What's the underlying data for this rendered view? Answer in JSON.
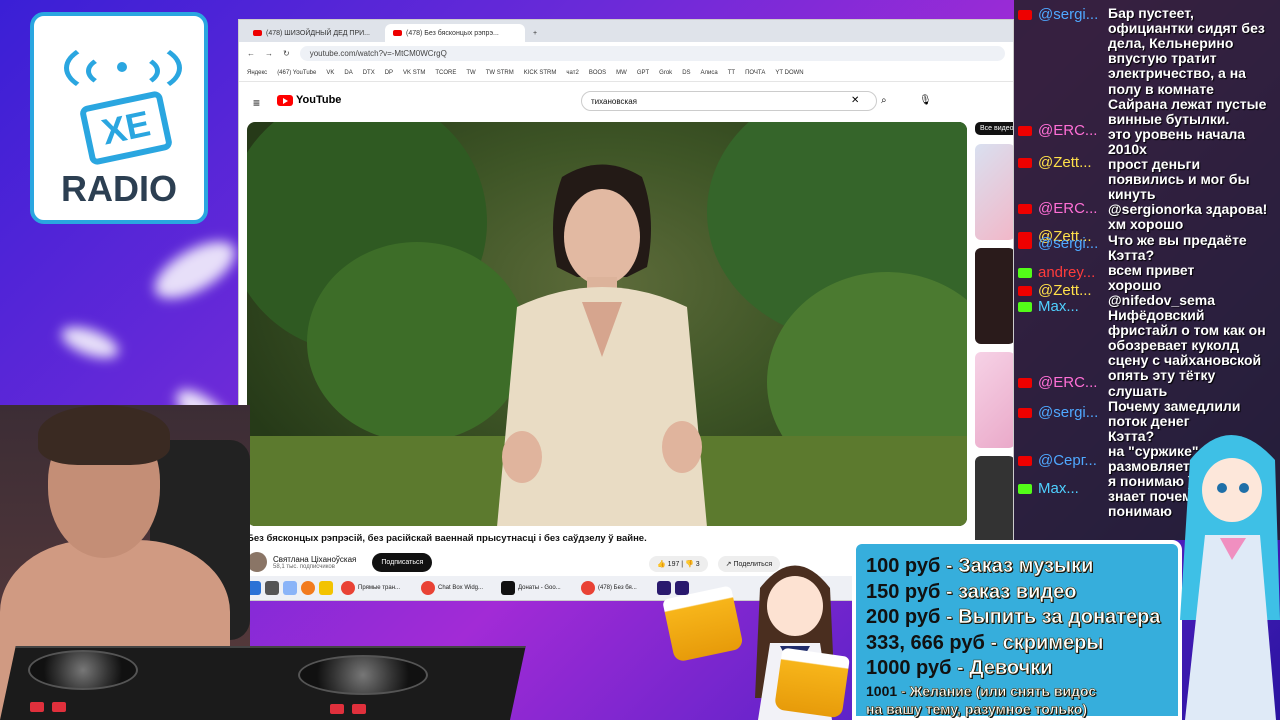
{
  "logo": {
    "text": "XE",
    "radio": "RADIO"
  },
  "browser": {
    "tabs": [
      {
        "label": "(478) ШИЗОЙДНЫЙ ДЕД ПРИ..."
      },
      {
        "label": "(478) Без бясконцых рэпрэ..."
      }
    ],
    "new_tab": "+",
    "url": "youtube.com/watch?v=-MtCM0WCrgQ",
    "bookmarks": [
      "Яндекс",
      "(467) YouTube",
      "VK",
      "DA",
      "DTX",
      "DP",
      "VK STM",
      "TCORE",
      "TW",
      "TW STRM",
      "KICK STRM",
      "чат2",
      "BOOS",
      "MW",
      "GPT",
      "Grok",
      "DS",
      "Алиса",
      "TT",
      "ПОЧТА",
      "YT DOWN"
    ],
    "search_value": "тихановская",
    "youtube_label": "YouTube",
    "sidebar_chip": "Все видео",
    "video": {
      "title": "Без бясконцых рэпрэсій, без расійскай ваеннай прысутнасці і без саўдзелу ў вайне.",
      "channel": "Святлана Ціханоўская",
      "subs": "58,1 тыс. подписчиков",
      "subscribe": "Подписаться",
      "likes": "197",
      "dislikes": "3",
      "share": "Поделиться"
    },
    "taskbar": [
      "Прямые тран...",
      "Chat Box Widg...",
      "Донаты - Goo...",
      "(478) Без бя..."
    ]
  },
  "chat": {
    "messages": [
      {
        "nick": "@sergi...",
        "source": "yt",
        "color": "#4fa8ff"
      },
      {
        "nick": "@ERC...",
        "source": "yt",
        "color": "#ff6fd6"
      },
      {
        "nick": "@Zett...",
        "source": "yt",
        "color": "#ffe04a"
      },
      {
        "nick": "@ERC...",
        "source": "yt",
        "color": "#ff6fd6"
      },
      {
        "nick": "@Zett...",
        "source": "yt",
        "color": "#ffe04a"
      },
      {
        "nick": "@sergi...",
        "source": "yt",
        "color": "#4fa8ff"
      },
      {
        "nick": "andrey...",
        "source": "kick",
        "color": "#ff3b3b"
      },
      {
        "nick": "@Zett...",
        "source": "yt",
        "color": "#ffe04a"
      },
      {
        "nick": "Max...",
        "source": "kick",
        "color": "#4fd0ff"
      },
      {
        "nick": "@ERC...",
        "source": "yt",
        "color": "#ff6fd6"
      },
      {
        "nick": "@sergi...",
        "source": "yt",
        "color": "#4fa8ff"
      },
      {
        "nick": "@Серг...",
        "source": "yt",
        "color": "#4fa8ff"
      },
      {
        "nick": "Max...",
        "source": "kick",
        "color": "#4fd0ff"
      }
    ],
    "text_lines": [
      "Бар пустеет,",
      "официантки сидят без",
      "дела, Кельнерино",
      "впустую тратит",
      "электричество, а на",
      "полу в комнате",
      "Сайрана лежат пустые",
      "винные бутылки.",
      "это уровень начала",
      "2010х",
      "прост деньги",
      "появились и мог бы",
      "кинуть",
      "@sergionorka здарова!",
      "хм хорошо",
      "Что же вы предаёте",
      "Кэтта?",
      "всем привет",
      "хорошо",
      "@nifedov_sema",
      "Нифёдовский",
      "фристайл о том как он",
      "обозревает куколд",
      "сцену с чайхановской",
      "опять эту тётку",
      "слушать",
      "Почему замедлили",
      "поток денег",
      "Кэтта?",
      "на \"суржике\"",
      "размовляет",
      "я понимаю ))",
      "знает почему",
      "понимаю"
    ]
  },
  "donations": [
    {
      "price": "100 руб",
      "label": " - Заказ музыки"
    },
    {
      "price": "150 руб",
      "label": " - заказ видео"
    },
    {
      "price": "200 руб",
      "label": " - Выпить за донатера"
    },
    {
      "price": "333, 666 руб",
      "label": " - скримеры"
    },
    {
      "price": "1000 руб",
      "label": " - Девочки"
    },
    {
      "price": "1001",
      "label": " - Желание (или снять видос"
    },
    {
      "price": "",
      "label": "на вашу тему, разумное только)"
    }
  ]
}
